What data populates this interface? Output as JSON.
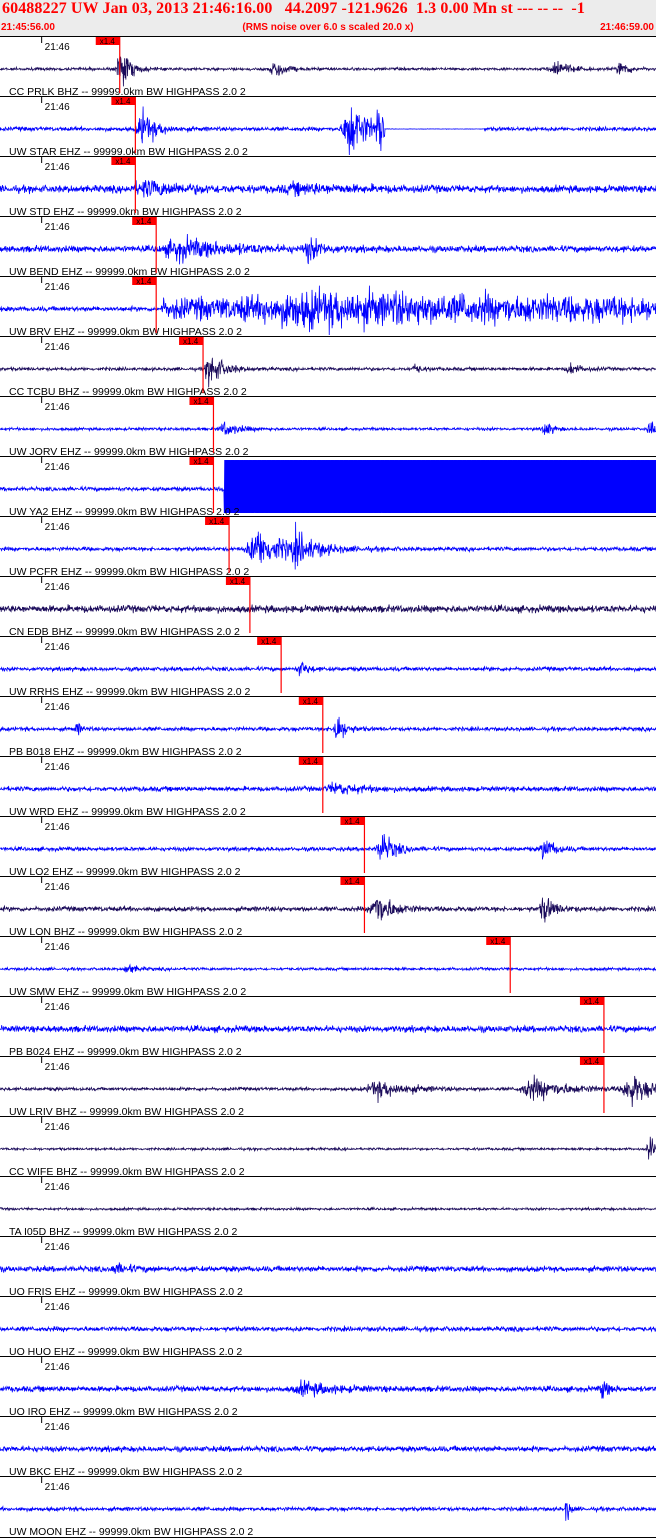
{
  "header": {
    "title": "60488227 UW Jan 03, 2013 21:46:16.00   44.2097 -121.9626  1.3 0.00 Mn st --- -- --  -1",
    "start_time": "21:45:56.00",
    "note": "(RMS noise over 6.0 s scaled 20.0 x)",
    "end_time": "21:46:59.00"
  },
  "colors": {
    "header_text": "#ff0000",
    "header_bg": "#ececec",
    "trace_blue": "#0000ff",
    "trace_dark": "#1a0a5a",
    "pick": "#ff0000",
    "separator": "#000000",
    "label": "#000000"
  },
  "chart_data": {
    "type": "line",
    "xlim": [
      "21:45:56.00",
      "21:46:59.00"
    ],
    "tick_label": "21:46",
    "tick_time_s": 4,
    "pick_label": "x1.4",
    "traces": [
      {
        "label": "CC PRLK BHZ -- 99999.0km BW  HIGHPASS  2.0  2",
        "color": "dark",
        "pick_s": 11.5,
        "events": [
          [
            11.8,
            1.2,
            0.9
          ],
          [
            26.5,
            0.6,
            1.0
          ],
          [
            53.5,
            0.6,
            1.2
          ],
          [
            59.8,
            0.45,
            0.9
          ]
        ],
        "noise": 0.07
      },
      {
        "label": "UW STAR EHZ -- 99999.0km BW  HIGHPASS  2.0  2",
        "color": "blue",
        "pick_s": 13.0,
        "events": [
          [
            14.0,
            0.9,
            1.4
          ],
          [
            34.0,
            1.6,
            1.8
          ],
          [
            36.5,
            1.2,
            0.6
          ]
        ],
        "noise": 0.1,
        "flat": [
          37.0,
          46.5
        ]
      },
      {
        "label": "UW STD EHZ -- 99999.0km BW  HIGHPASS  2.0  2",
        "color": "blue",
        "pick_s": 13.0,
        "events": [
          [
            15.0,
            0.35,
            4.0
          ],
          [
            30.0,
            0.2,
            5.0
          ]
        ],
        "noise": 0.18
      },
      {
        "label": "UW BEND EHZ -- 99999.0km BW  HIGHPASS  2.0  2",
        "color": "blue",
        "pick_s": 15.0,
        "events": [
          [
            18.5,
            0.5,
            5.0
          ],
          [
            30.0,
            0.55,
            1.2
          ]
        ],
        "noise": 0.16
      },
      {
        "label": "UW BRV EHZ -- 99999.0km BW  HIGHPASS  2.0  2",
        "color": "blue",
        "pick_s": 15.0,
        "events": [
          [
            36.0,
            0.5,
            22.0
          ]
        ],
        "noise": 0.12,
        "sustain_after": 15.5
      },
      {
        "label": "CC TCBU BHZ -- 99999.0km BW  HIGHPASS  2.0  2",
        "color": "dark",
        "pick_s": 19.5,
        "events": [
          [
            20.5,
            0.9,
            1.3
          ],
          [
            40.0,
            0.25,
            0.6
          ],
          [
            55.0,
            0.3,
            1.0
          ]
        ],
        "noise": 0.08
      },
      {
        "label": "UW JORV EHZ -- 99999.0km BW  HIGHPASS  2.0  2",
        "color": "blue",
        "pick_s": 20.5,
        "events": [
          [
            22.0,
            0.35,
            1.5
          ],
          [
            52.5,
            0.5,
            0.6
          ],
          [
            62.5,
            0.55,
            0.4
          ]
        ],
        "noise": 0.07
      },
      {
        "label": "UW YA2 EHZ -- 99999.0km BW  HIGHPASS  2.0  2",
        "color": "blue",
        "pick_s": 20.5,
        "events": [],
        "noise": 0.1,
        "saturate_after": 21.5
      },
      {
        "label": "UW PCFR EHZ -- 99999.0km BW  HIGHPASS  2.0  2",
        "color": "blue",
        "pick_s": 22.0,
        "events": [
          [
            25.5,
            1.0,
            3.0
          ],
          [
            29.0,
            0.6,
            2.0
          ]
        ],
        "noise": 0.1
      },
      {
        "label": "CN EDB BHZ -- 99999.0km BW  HIGHPASS  2.0  2",
        "color": "dark",
        "pick_s": 24.0,
        "events": [],
        "noise": 0.18
      },
      {
        "label": "UW RRHS EHZ -- 99999.0km BW  HIGHPASS  2.0  2",
        "color": "blue",
        "pick_s": 27.0,
        "events": [
          [
            29.0,
            0.45,
            0.7
          ]
        ],
        "noise": 0.1
      },
      {
        "label": "PB B018 EHZ -- 99999.0km BW  HIGHPASS  2.0  2",
        "color": "blue",
        "pick_s": 31.0,
        "events": [
          [
            7.5,
            0.35,
            0.4
          ],
          [
            32.5,
            0.9,
            0.8
          ]
        ],
        "noise": 0.1
      },
      {
        "label": "UW WRD EHZ -- 99999.0km BW  HIGHPASS  2.0  2",
        "color": "blue",
        "pick_s": 31.0,
        "events": [
          [
            33.0,
            0.25,
            3.0
          ]
        ],
        "noise": 0.12
      },
      {
        "label": "UW LO2 EHZ -- 99999.0km BW  HIGHPASS  2.0  2",
        "color": "blue",
        "pick_s": 35.0,
        "events": [
          [
            37.0,
            0.8,
            1.3
          ],
          [
            52.5,
            0.6,
            1.0
          ]
        ],
        "noise": 0.1
      },
      {
        "label": "UW LON BHZ -- 99999.0km BW  HIGHPASS  2.0  2",
        "color": "dark",
        "pick_s": 35.0,
        "events": [
          [
            36.5,
            0.95,
            1.5
          ],
          [
            52.5,
            0.7,
            1.0
          ]
        ],
        "noise": 0.12
      },
      {
        "label": "UW SMW EHZ -- 99999.0km BW  HIGHPASS  2.0  2",
        "color": "blue",
        "pick_s": 49.0,
        "events": [
          [
            12.5,
            0.25,
            1.0
          ]
        ],
        "noise": 0.07
      },
      {
        "label": "PB B024 EHZ -- 99999.0km BW  HIGHPASS  2.0  2",
        "color": "blue",
        "pick_s": 58.0,
        "events": [],
        "noise": 0.16
      },
      {
        "label": "UW LRIV BHZ -- 99999.0km BW  HIGHPASS  2.0  2",
        "color": "dark",
        "pick_s": 58.0,
        "events": [
          [
            37.0,
            0.45,
            3.0
          ],
          [
            52.0,
            0.55,
            3.5
          ],
          [
            61.0,
            0.85,
            2.0
          ]
        ],
        "noise": 0.08
      },
      {
        "label": "CC WIFE BHZ -- 99999.0km BW  HIGHPASS  2.0  2",
        "color": "dark",
        "events": [
          [
            62.5,
            0.8,
            0.5
          ]
        ],
        "noise": 0.06
      },
      {
        "label": "TA I05D BHZ -- 99999.0km BW  HIGHPASS  2.0  2",
        "color": "dark",
        "events": [],
        "noise": 0.06
      },
      {
        "label": "UO FRIS EHZ -- 99999.0km BW  HIGHPASS  2.0  2",
        "color": "blue",
        "events": [
          [
            11.5,
            0.22,
            1.5
          ]
        ],
        "noise": 0.14
      },
      {
        "label": "UO HUO EHZ -- 99999.0km BW  HIGHPASS  2.0  2",
        "color": "blue",
        "events": [],
        "noise": 0.12
      },
      {
        "label": "UO IRO EHZ -- 99999.0km BW  HIGHPASS  2.0  2",
        "color": "blue",
        "events": [
          [
            30.0,
            0.3,
            3.0
          ],
          [
            58.0,
            0.55,
            0.5
          ]
        ],
        "noise": 0.14
      },
      {
        "label": "UW BKC EHZ -- 99999.0km BW  HIGHPASS  2.0  2",
        "color": "blue",
        "events": [],
        "noise": 0.14
      },
      {
        "label": "UW MOON EHZ -- 99999.0km BW  HIGHPASS  2.0  2",
        "color": "blue",
        "events": [
          [
            54.5,
            0.75,
            0.3
          ]
        ],
        "noise": 0.1
      }
    ]
  }
}
